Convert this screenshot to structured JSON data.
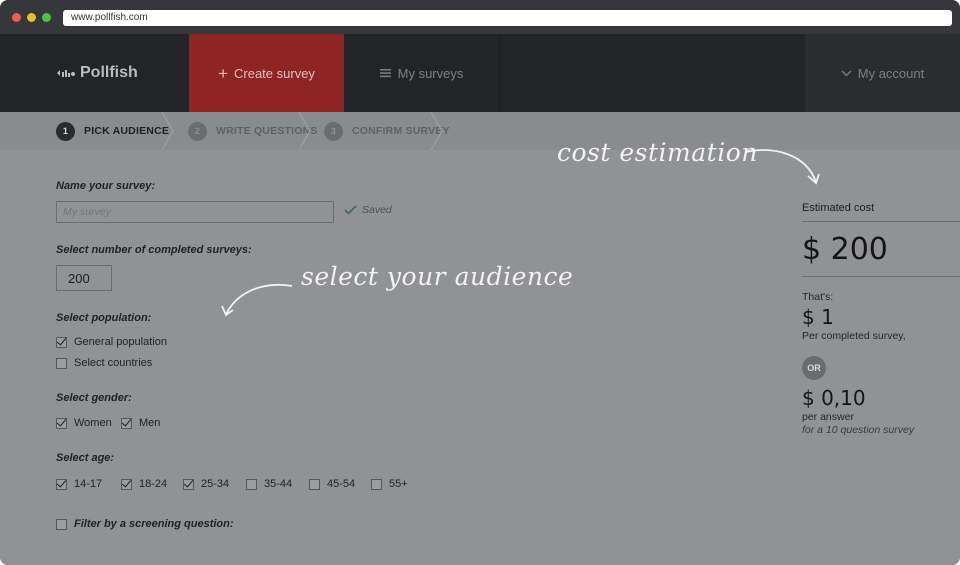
{
  "browser": {
    "url": "www.pollfish.com"
  },
  "nav": {
    "brand": "Pollfish",
    "create_survey": "Create survey",
    "my_surveys": "My surveys",
    "my_account": "My account"
  },
  "steps": [
    {
      "num": "1",
      "label": "PICK AUDIENCE",
      "state": "active"
    },
    {
      "num": "2",
      "label": "WRITE QUESTIONS",
      "state": "inactive"
    },
    {
      "num": "3",
      "label": "CONFIRM SURVEY",
      "state": "inactive"
    }
  ],
  "form": {
    "name_label": "Name your survey:",
    "name_placeholder": "My survey",
    "saved_label": "Saved",
    "count_label": "Select number of completed surveys:",
    "count_value": "200",
    "population_label": "Select population:",
    "population_options": [
      {
        "label": "General population",
        "checked": true
      },
      {
        "label": "Select countries",
        "checked": false
      }
    ],
    "gender_label": "Select gender:",
    "gender_options": [
      {
        "label": "Women",
        "checked": true
      },
      {
        "label": "Men",
        "checked": true
      }
    ],
    "age_label": "Select age:",
    "age_options": [
      {
        "label": "14-17",
        "checked": true
      },
      {
        "label": "18-24",
        "checked": true
      },
      {
        "label": "25-34",
        "checked": true
      },
      {
        "label": "35-44",
        "checked": false
      },
      {
        "label": "45-54",
        "checked": false
      },
      {
        "label": "55+",
        "checked": false
      }
    ],
    "screening_label": "Filter by a screening question:",
    "screening_checked": false
  },
  "annotations": {
    "audience": "select your audience",
    "cost": "cost estimation"
  },
  "cost": {
    "title": "Estimated cost",
    "total": "$ 200",
    "thats": "That's:",
    "per_survey": "$ 1",
    "per_survey_label": "Per completed survey,",
    "or": "OR",
    "per_answer": "$ 0,10",
    "per_answer_label": "per answer",
    "per_answer_note": "for a 10 question survey"
  },
  "colors": {
    "accent": "#8f2424",
    "nav_bg": "#232427",
    "page_bg": "#909295"
  }
}
